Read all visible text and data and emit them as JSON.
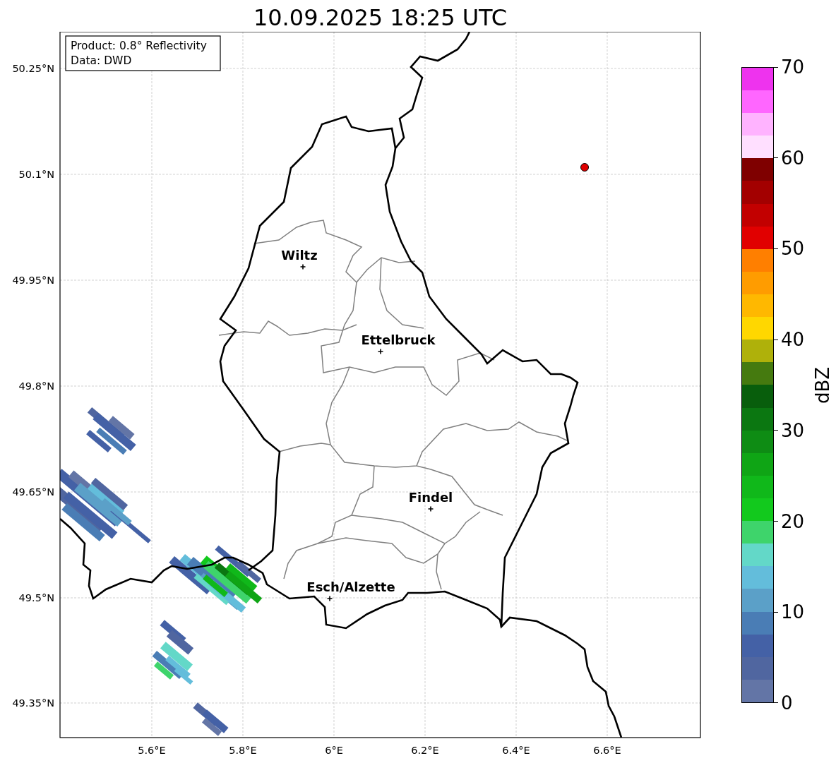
{
  "title": "10.09.2025 18:25 UTC",
  "info_box": {
    "lines": [
      "Product: 0.8° Reflectivity",
      "Data: DWD"
    ]
  },
  "map": {
    "x_ticks": [
      "5.6°E",
      "5.8°E",
      "6°E",
      "6.2°E",
      "6.4°E",
      "6.6°E"
    ],
    "y_ticks": [
      "50.25°N",
      "50.1°N",
      "49.95°N",
      "49.8°N",
      "49.65°N",
      "49.5°N",
      "49.35°N"
    ],
    "cities": [
      {
        "name": "Wiltz"
      },
      {
        "name": "Ettelbruck"
      },
      {
        "name": "Findel"
      },
      {
        "name": "Esch/Alzette"
      }
    ]
  },
  "colorbar": {
    "label": "dBZ",
    "ticks": [
      "70",
      "60",
      "50",
      "40",
      "30",
      "20",
      "10",
      "0"
    ],
    "segments": [
      {
        "color": "#6375a6"
      },
      {
        "color": "#5066a0"
      },
      {
        "color": "#4461a6"
      },
      {
        "color": "#4a7db5"
      },
      {
        "color": "#5ba0c8"
      },
      {
        "color": "#63bddb"
      },
      {
        "color": "#63d8c8"
      },
      {
        "color": "#3ed46b"
      },
      {
        "color": "#12c91d"
      },
      {
        "color": "#10b81a"
      },
      {
        "color": "#0fa515"
      },
      {
        "color": "#0e8c14"
      },
      {
        "color": "#0b7711"
      },
      {
        "color": "#085e0c"
      },
      {
        "color": "#457a0f"
      },
      {
        "color": "#afb10a"
      },
      {
        "color": "#ffd700"
      },
      {
        "color": "#ffb800"
      },
      {
        "color": "#ff9c00"
      },
      {
        "color": "#ff7f00"
      },
      {
        "color": "#e10000"
      },
      {
        "color": "#c20000"
      },
      {
        "color": "#a30000"
      },
      {
        "color": "#7f0000"
      },
      {
        "color": "#ffdfff"
      },
      {
        "color": "#ffb3ff"
      },
      {
        "color": "#ff66ff"
      },
      {
        "color": "#ee33ee"
      }
    ]
  }
}
